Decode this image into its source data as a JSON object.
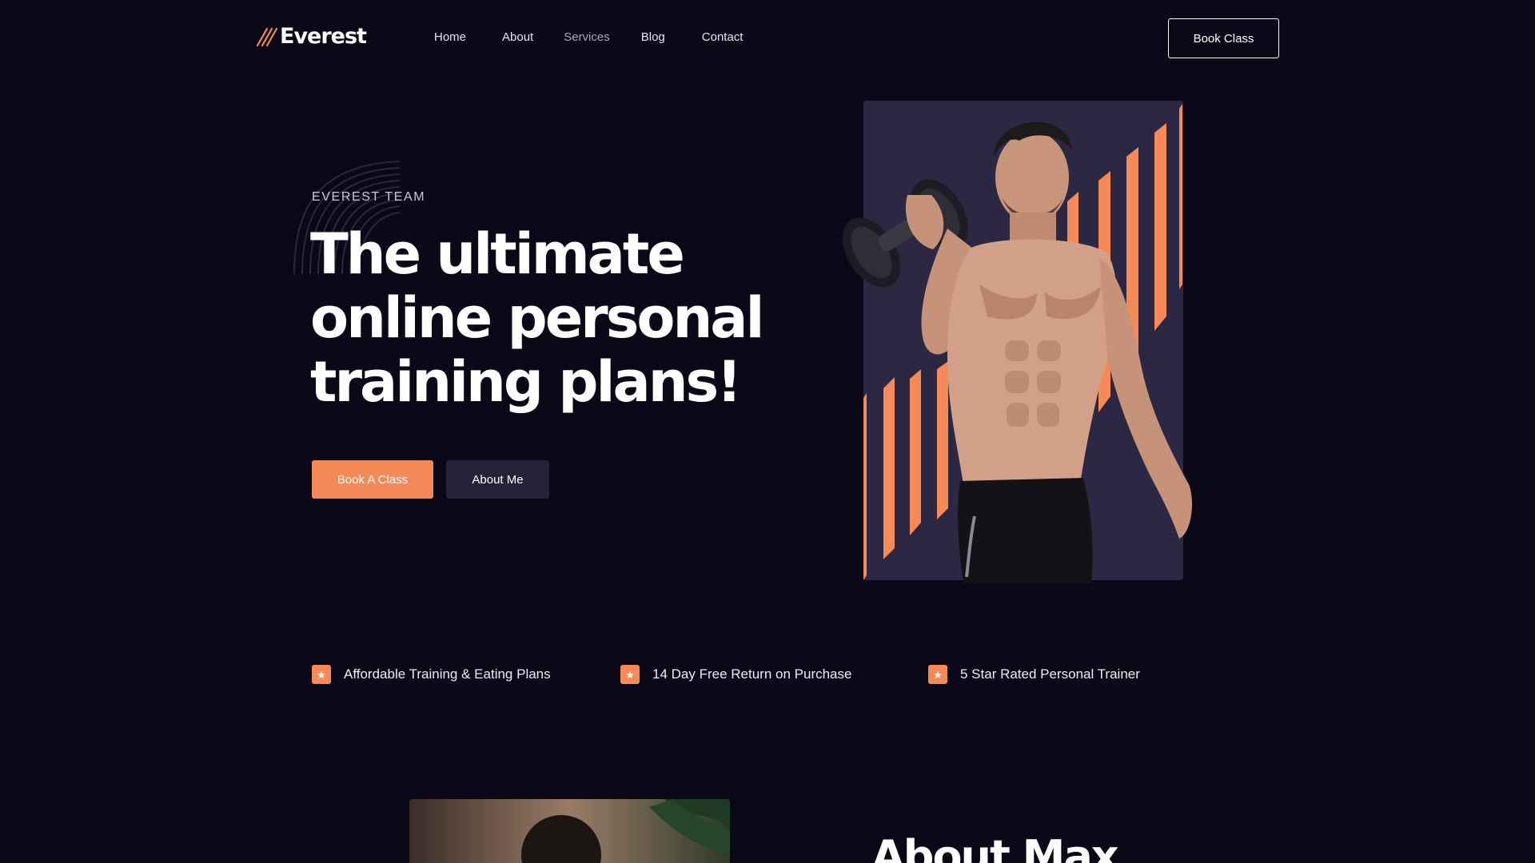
{
  "brand": {
    "name": "Everest",
    "accent": "#f48a58",
    "background": "#0b0918"
  },
  "nav": {
    "links": [
      {
        "label": "Home"
      },
      {
        "label": "About"
      },
      {
        "label": "Services"
      },
      {
        "label": "Blog"
      },
      {
        "label": "Contact"
      }
    ],
    "cta_label": "Book Class"
  },
  "hero": {
    "eyebrow": "EVEREST TEAM",
    "headline_lines": [
      "The ultimate",
      "online personal",
      "training plans!"
    ],
    "primary_button": "Book A Class",
    "secondary_button": "About Me",
    "image_icon": "man-with-dumbbell-photo"
  },
  "features": [
    {
      "icon": "star-icon",
      "text": "Affordable Training & Eating Plans"
    },
    {
      "icon": "star-icon",
      "text": "14 Day Free Return on Purchase"
    },
    {
      "icon": "star-icon",
      "text": "5 Star Rated Personal Trainer"
    }
  ],
  "about": {
    "title": "About Max",
    "image_icon": "trainer-portrait-photo"
  }
}
